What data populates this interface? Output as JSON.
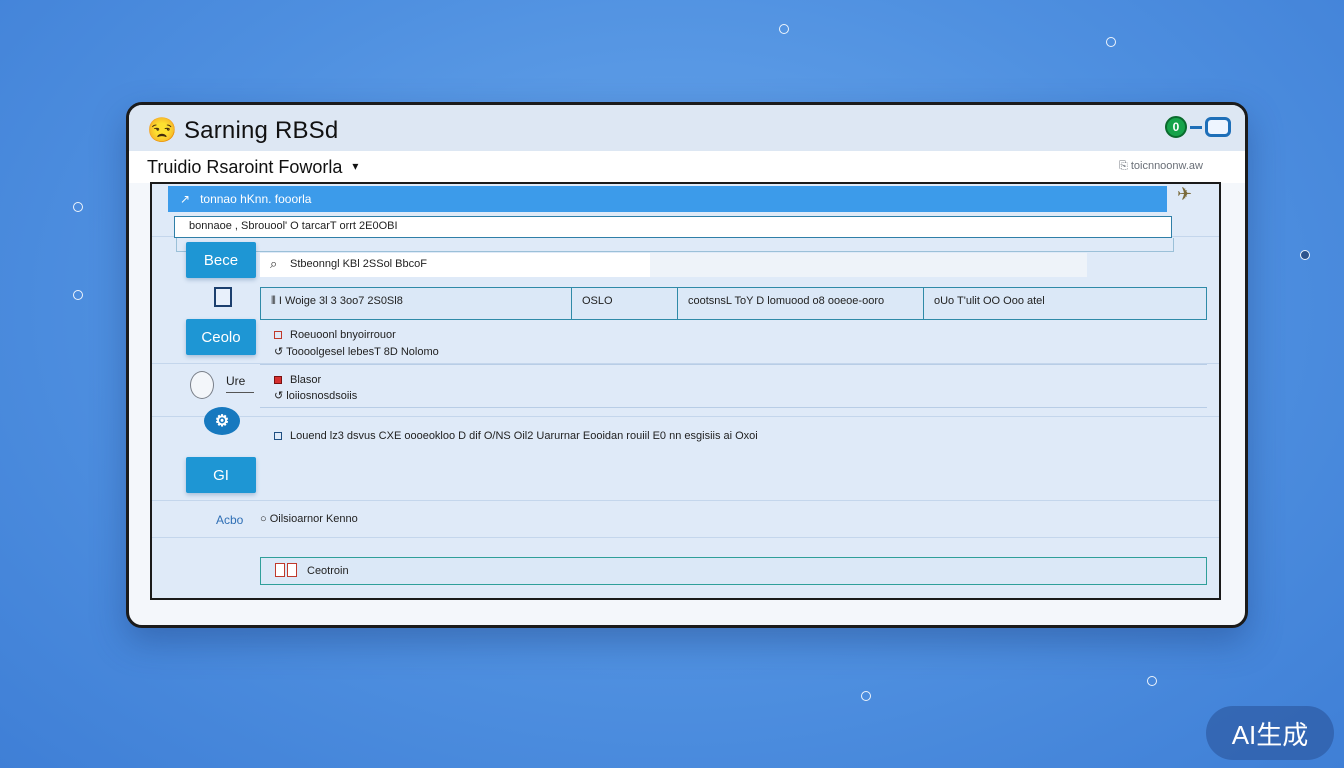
{
  "window": {
    "title": "😒 Sarning RBSd",
    "subtitle": "Truidio Rsaroint Foworla",
    "subtitle_caret": "▾",
    "status": "toicnnoonw.aw"
  },
  "toolbar": {
    "arrow": "↗",
    "label": "tonnao hKnn.  fooorla"
  },
  "path_bar": {
    "value": "bonnaoe  ,    Sbrouool'  O  tarcarT orrt  2E0OBI"
  },
  "search": {
    "value": "Stbeonngl KBl 2SSol BbcoF"
  },
  "sidebar": {
    "btn_top": "Bece",
    "btn_mid": "Ceolo",
    "speaker_label": "Ure",
    "gear_glyph": "⚙",
    "btn_bottom": "GI",
    "link": "Acbo"
  },
  "table": {
    "row_cells": [
      "⦀  I Woige 3l 3  3oo7 2S0Sl8",
      "OSLO",
      "cootsnsL ToY  D lomuood o8  ooeoe-ooro",
      "oUo T'ulit OO Ooo atel"
    ]
  },
  "info": {
    "block1_line1": "Roeuoonl bnyoirrouor",
    "block1_line2": "Toooolgesel lebesT  8D  Nolomo",
    "block2_line1": "Blasor",
    "block2_line2": "loiiosnosdsoiis",
    "full_row": "Louend lz3 dsvus CXE oooeokloo D dif O/NS Oil2 Uarurnar Eooidan rouiil E0 nn esgisiis ai Oxoi",
    "sel_label": "Ceotroin",
    "bottom_line": "Oilsioarnor Kenno"
  },
  "watermark": "AI生成",
  "colors": {
    "background": "#4f90e0",
    "toolbar": "#3c9bea",
    "sidebar_button": "#1e96d4",
    "row_border": "#2f8aa8",
    "window_control": "#16a34a"
  },
  "icons": {
    "window_controls": [
      "green-circle-icon",
      "dash-icon",
      "window-icon"
    ],
    "sidebar": [
      "phone-icon",
      "speaker-icon",
      "gear-icon",
      "link-icon"
    ],
    "rows": [
      "checkbox-icon",
      "phone-red-icon"
    ]
  }
}
